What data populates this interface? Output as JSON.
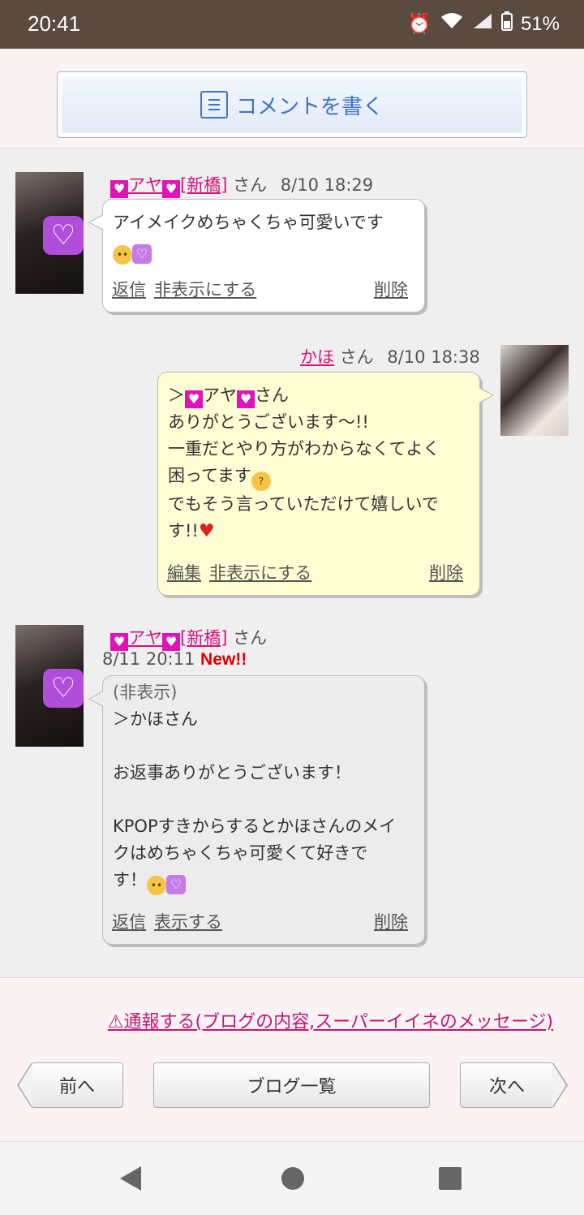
{
  "status_bar": {
    "time": "20:41",
    "battery": "51%"
  },
  "compose": {
    "label": "コメントを書く"
  },
  "comments": [
    {
      "user_name": "アヤ",
      "user_tag": "[新橋]",
      "honorific": "さん",
      "date": "8/10 18:29",
      "lines": [
        "アイメイクめちゃくちゃ可愛いです"
      ],
      "actions": {
        "reply": "返信",
        "hide": "非表示にする",
        "delete": "削除"
      }
    },
    {
      "user_name": "かほ",
      "honorific": "さん",
      "date": "8/10 18:38",
      "lines": [
        "＞",
        "アヤ",
        "さん",
        "ありがとうございます〜!!",
        "一重だとやり方がわからなくてよく",
        "困ってます",
        "でもそう言っていただけて嬉しいで",
        "す!!"
      ],
      "actions": {
        "edit": "編集",
        "hide": "非表示にする",
        "delete": "削除"
      }
    },
    {
      "user_name": "アヤ",
      "user_tag": "[新橋]",
      "honorific": "さん",
      "date": "8/11 20:11",
      "badge": "New!!",
      "hidden_label": "(非表示)",
      "lines": [
        "＞かほさん",
        "",
        "お返事ありがとうございます！",
        "",
        "KPOPすきからするとかほさんのメイ",
        "クはめちゃくちゃ可愛くて好きで",
        "す！"
      ],
      "actions": {
        "reply": "返信",
        "show": "表示する",
        "delete": "削除"
      }
    }
  ],
  "report_link": "⚠通報する(ブログの内容,スーパーイイネのメッセージ)",
  "nav": {
    "prev": "前へ",
    "list": "ブログ一覧",
    "next": "次へ"
  }
}
